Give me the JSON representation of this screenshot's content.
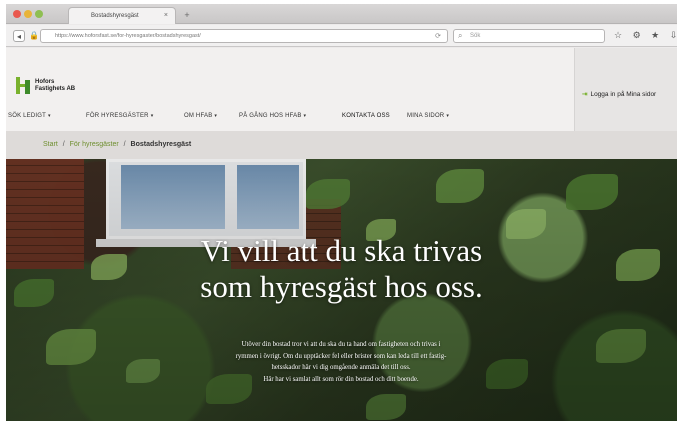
{
  "browser": {
    "tab_title": "Bostadshyresgäst",
    "tab_close": "×",
    "new_tab": "+",
    "url": "https://www.hoforsfast.se/for-hyresgaster/bostadshyresgast/",
    "search_placeholder": "Sök",
    "toolbar_icons": "☆ ⚙ ★ ⇩"
  },
  "site": {
    "logo_line1": "Hofors",
    "logo_line2": "Fastighets AB",
    "nav": [
      {
        "label": "SÖK LEDIGT"
      },
      {
        "label": "FÖR HYRESGÄSTER"
      },
      {
        "label": "OM HFAB"
      },
      {
        "label": "PÅ GÅNG HOS HFAB"
      },
      {
        "label": "KONTAKTA OSS"
      },
      {
        "label": "MINA SIDOR"
      }
    ],
    "caret": "▾",
    "login_label": "Logga in på Mina sidor"
  },
  "breadcrumb": {
    "home": "Start",
    "section": "För hyresgäster",
    "current": "Bostadshyresgäst",
    "separator": "/"
  },
  "hero": {
    "title_line1": "Vi vill att du ska trivas",
    "title_line2": "som hyresgäst hos oss.",
    "body_line1": "Utöver din bostad tror vi att du ska du ta hand om fastigheten och trivas i",
    "body_line2": "rymmen i övrigt. Om du upptäcker fel eller brister som kan leda till ett fastig-",
    "body_line3": "hetsskador här vi dig omgående anmäla det till oss.",
    "body_line4": "Här har vi samlat allt som rör din bostad och ditt boende."
  },
  "colors": {
    "brand_green": "#79b12d",
    "brand_dark_green": "#3e8b2a",
    "breadcrumb_link": "#6f8f2f"
  }
}
